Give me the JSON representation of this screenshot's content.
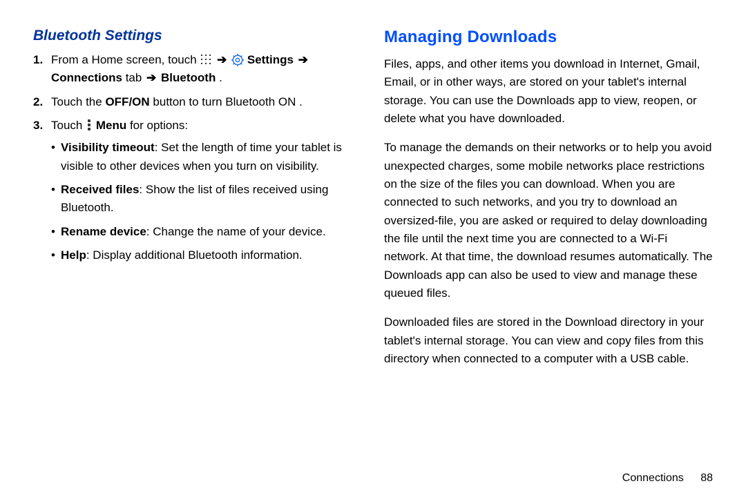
{
  "left": {
    "heading": "Bluetooth Settings",
    "step1": {
      "num": "1.",
      "t1": "From a Home screen, touch ",
      "settings": "Settings",
      "t2": "Connections",
      "t3": " tab ",
      "bluetooth": "Bluetooth",
      "period": "."
    },
    "step2": {
      "num": "2.",
      "t1": "Touch the ",
      "offon": "OFF/ON",
      "t2": " button to turn Bluetooth ON ."
    },
    "step3": {
      "num": "3.",
      "t1": "Touch ",
      "menu": "Menu",
      "t2": " for options:"
    },
    "opts": {
      "o1b": "Visibility timeout",
      "o1": ": Set the length of time your tablet is visible to other devices when you turn on visibility.",
      "o2b": "Received files",
      "o2": ": Show the list of files received using Bluetooth.",
      "o3b": "Rename device",
      "o3": ": Change the name of your device.",
      "o4b": "Help",
      "o4": ": Display additional Bluetooth information."
    }
  },
  "right": {
    "heading": "Managing Downloads",
    "p1": "Files, apps, and other items you download in Internet, Gmail, Email, or in other ways, are stored on your tablet's internal storage. You can use the Downloads app to view, reopen, or delete what you have downloaded.",
    "p2": "To manage the demands on their networks or to help you avoid unexpected charges, some mobile networks place restrictions on the size of the files you can download. When you are connected to such networks, and you try to download an oversized-file, you are asked or required to delay downloading the file until the next time you are connected to a Wi-Fi network. At that time, the download resumes automatically. The Downloads app can also be used to view and manage these queued files.",
    "p3": "Downloaded files are stored in the Download directory in your tablet's internal storage. You can view and copy files from this directory when connected to a computer with a USB cable."
  },
  "footer": {
    "chapter": "Connections",
    "page": "88"
  },
  "glyphs": {
    "arrow": "➔"
  }
}
